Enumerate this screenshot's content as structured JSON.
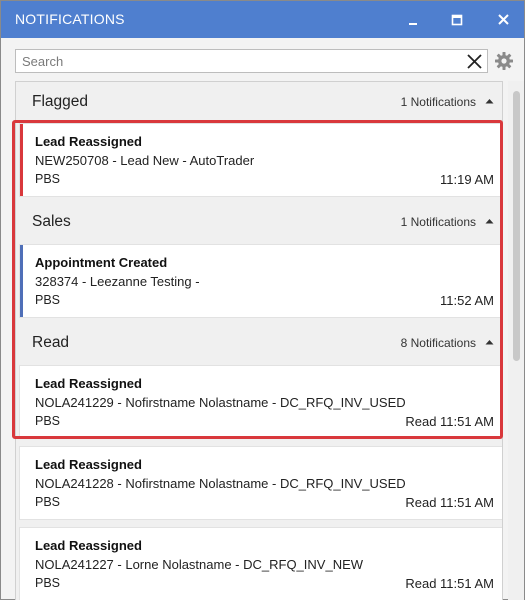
{
  "window": {
    "title": "NOTIFICATIONS"
  },
  "search": {
    "placeholder": "Search",
    "value": ""
  },
  "groups": [
    {
      "title": "Flagged",
      "count": "1 Notifications",
      "notifications": [
        {
          "title": "Lead Reassigned",
          "subtitle": "NEW250708 - Lead New - AutoTrader",
          "source": "PBS",
          "time": "11:19 AM",
          "accent": "#d9383c"
        }
      ]
    },
    {
      "title": "Sales",
      "count": "1 Notifications",
      "notifications": [
        {
          "title": "Appointment Created",
          "subtitle": "328374 - Leezanne Testing -",
          "source": "PBS",
          "time": "11:52 AM",
          "accent": "#4f6fb8"
        }
      ]
    },
    {
      "title": "Read",
      "count": "8 Notifications",
      "notifications": [
        {
          "title": "Lead Reassigned",
          "subtitle": "NOLA241229 - Nofirstname Nolastname - DC_RFQ_INV_USED",
          "source": "PBS",
          "time": "Read 11:51 AM"
        },
        {
          "title": "Lead Reassigned",
          "subtitle": "NOLA241228 - Nofirstname Nolastname - DC_RFQ_INV_USED",
          "source": "PBS",
          "time": "Read 11:51 AM"
        },
        {
          "title": "Lead Reassigned",
          "subtitle": "NOLA241227 - Lorne Nolastname - DC_RFQ_INV_NEW",
          "source": "PBS",
          "time": "Read 11:51 AM"
        }
      ]
    }
  ],
  "colors": {
    "titlebar": "#4f7fcf",
    "highlight": "#d9383c",
    "flagged_accent": "#d9383c",
    "sales_accent": "#4f6fb8"
  }
}
